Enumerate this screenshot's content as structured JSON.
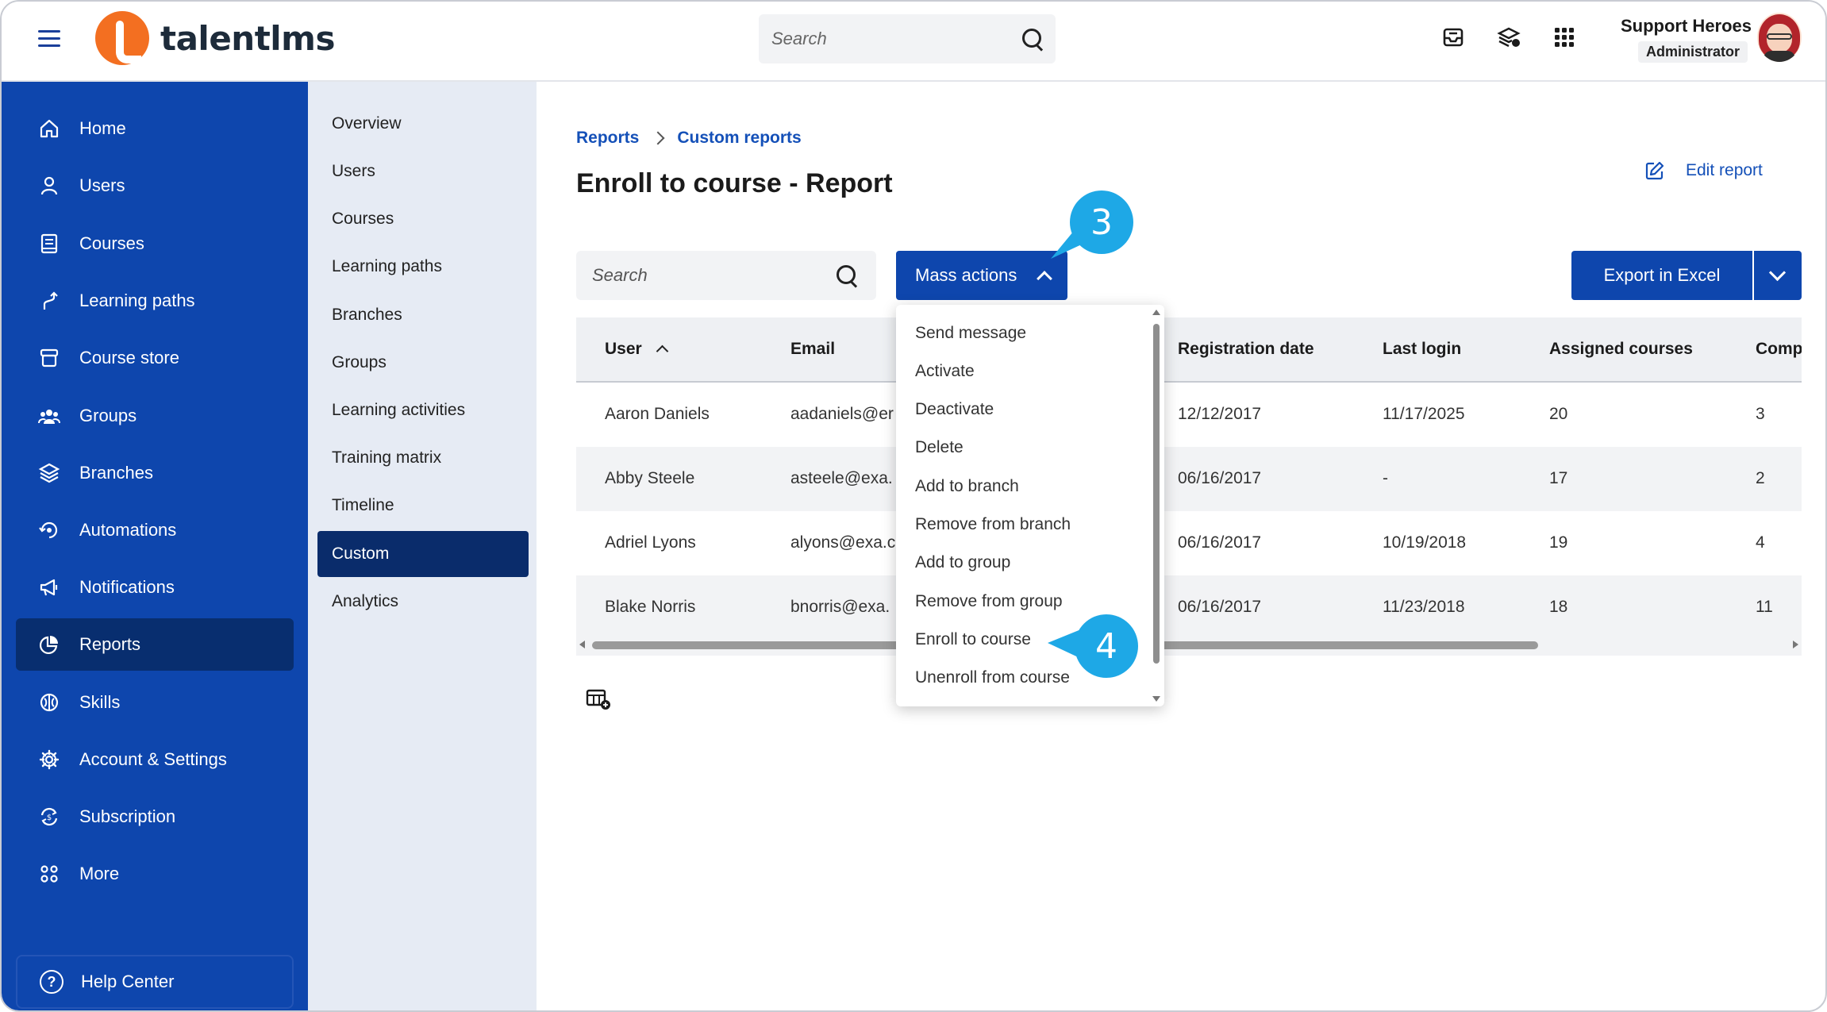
{
  "app": {
    "logo_text": "talentlms"
  },
  "topbar": {
    "search_placeholder": "Search",
    "icons": [
      "inbox-icon",
      "layers-check-icon",
      "apps-grid-icon"
    ],
    "user_name": "Support Heroes",
    "user_role": "Administrator"
  },
  "sidebar": {
    "items": [
      {
        "label": "Home",
        "icon": "home-icon"
      },
      {
        "label": "Users",
        "icon": "user-icon"
      },
      {
        "label": "Courses",
        "icon": "book-icon"
      },
      {
        "label": "Learning paths",
        "icon": "path-icon"
      },
      {
        "label": "Course store",
        "icon": "store-icon"
      },
      {
        "label": "Groups",
        "icon": "groups-icon"
      },
      {
        "label": "Branches",
        "icon": "branches-icon"
      },
      {
        "label": "Automations",
        "icon": "automation-icon"
      },
      {
        "label": "Notifications",
        "icon": "megaphone-icon"
      },
      {
        "label": "Reports",
        "icon": "pie-chart-icon",
        "active": true
      },
      {
        "label": "Skills",
        "icon": "brain-icon"
      },
      {
        "label": "Account & Settings",
        "icon": "gear-icon"
      },
      {
        "label": "Subscription",
        "icon": "subscription-icon"
      },
      {
        "label": "More",
        "icon": "more-grid-icon"
      }
    ],
    "help_label": "Help Center",
    "help_icon": "?"
  },
  "subnav": {
    "items": [
      "Overview",
      "Users",
      "Courses",
      "Learning paths",
      "Branches",
      "Groups",
      "Learning activities",
      "Training matrix",
      "Timeline",
      "Custom",
      "Analytics"
    ],
    "active": "Custom"
  },
  "main": {
    "breadcrumb": [
      "Reports",
      "Custom reports"
    ],
    "title": "Enroll to course - Report",
    "edit_label": "Edit report",
    "search_placeholder": "Search",
    "mass_actions_label": "Mass actions",
    "export_label": "Export in Excel"
  },
  "table": {
    "columns": [
      "User",
      "Email",
      "Registration date",
      "Last login",
      "Assigned courses",
      "Comp"
    ],
    "rows": [
      {
        "user": "Aaron Daniels",
        "email": "aadaniels@er",
        "registered": "12/12/2017",
        "last_login": "11/17/2025",
        "assigned": "20",
        "completed": "3"
      },
      {
        "user": "Abby Steele",
        "email": "asteele@exa.",
        "registered": "06/16/2017",
        "last_login": "-",
        "assigned": "17",
        "completed": "2"
      },
      {
        "user": "Adriel Lyons",
        "email": "alyons@exa.c",
        "registered": "06/16/2017",
        "last_login": "10/19/2018",
        "assigned": "19",
        "completed": "4"
      },
      {
        "user": "Blake Norris",
        "email": "bnorris@exa.",
        "registered": "06/16/2017",
        "last_login": "11/23/2018",
        "assigned": "18",
        "completed": "11"
      }
    ]
  },
  "mass_actions_menu": [
    "Send message",
    "Activate",
    "Deactivate",
    "Delete",
    "Add to branch",
    "Remove from branch",
    "Add to group",
    "Remove from group",
    "Enroll to course",
    "Unenroll from course"
  ],
  "callouts": {
    "step3": "3",
    "step4": "4"
  },
  "colors": {
    "brand_blue": "#0e46ad",
    "active_nav": "#082e6f",
    "logo_orange": "#f36f21",
    "callout": "#1ea8e6",
    "link": "#1450b8"
  }
}
